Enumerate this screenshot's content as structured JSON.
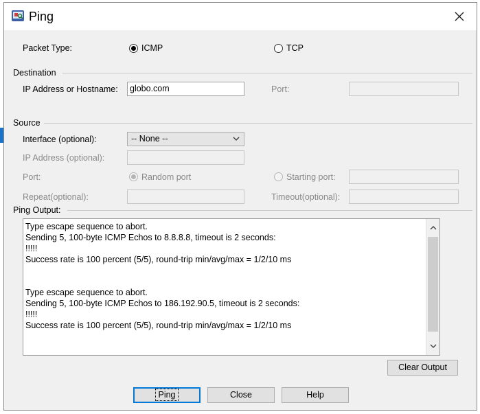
{
  "window": {
    "title": "Ping"
  },
  "packet_type": {
    "label": "Packet Type:",
    "options": [
      {
        "label": "ICMP",
        "selected": true
      },
      {
        "label": "TCP",
        "selected": false
      }
    ]
  },
  "destination": {
    "section_title": "Destination",
    "host_label": "IP Address or Hostname:",
    "host_value": "globo.com",
    "port_label": "Port:",
    "port_value": ""
  },
  "source": {
    "section_title": "Source",
    "interface_label": "Interface (optional):",
    "interface_value": "-- None --",
    "ip_label": "IP Address (optional):",
    "ip_value": "",
    "port_label": "Port:",
    "random_port_label": "Random port",
    "starting_port_label": "Starting port:",
    "starting_port_value": "",
    "repeat_label": "Repeat(optional):",
    "repeat_value": "",
    "timeout_label": "Timeout(optional):",
    "timeout_value": ""
  },
  "output": {
    "section_title": "Ping Output:",
    "lines": [
      "Type escape sequence to abort.",
      "Sending 5, 100-byte ICMP Echos to 8.8.8.8, timeout is 2 seconds:",
      "!!!!!",
      "Success rate is 100 percent (5/5), round-trip min/avg/max = 1/2/10 ms",
      "",
      "",
      "Type escape sequence to abort.",
      "Sending 5, 100-byte ICMP Echos to 186.192.90.5, timeout is 2 seconds:",
      "!!!!!",
      "Success rate is 100 percent (5/5), round-trip min/avg/max = 1/2/10 ms"
    ],
    "clear_label": "Clear Output"
  },
  "buttons": {
    "ping": "Ping",
    "close": "Close",
    "help": "Help"
  },
  "colors": {
    "accent": "#0078d7",
    "dialog_bg": "#f0f0f0",
    "disabled_text": "#8a8a8a"
  }
}
